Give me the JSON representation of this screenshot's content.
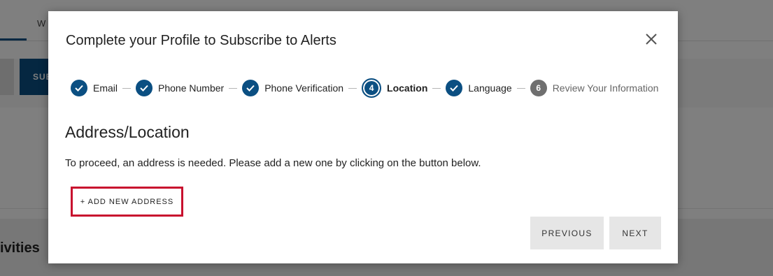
{
  "background": {
    "tab_label": "W",
    "sub_button_label": "SUB",
    "section_title": "ivities"
  },
  "modal": {
    "title": "Complete your Profile to Subscribe to Alerts",
    "close_icon": "close-icon",
    "steps": [
      {
        "label": "Email",
        "status": "complete"
      },
      {
        "label": "Phone Number",
        "status": "complete"
      },
      {
        "label": "Phone Verification",
        "status": "complete"
      },
      {
        "label": "Location",
        "status": "current",
        "number": "4"
      },
      {
        "label": "Language",
        "status": "complete"
      },
      {
        "label": "Review Your Information",
        "status": "pending",
        "number": "6"
      }
    ],
    "section_heading": "Address/Location",
    "info_text": "To proceed, an address is needed. Please add a new one by clicking on the button below.",
    "add_address_label": "+ ADD NEW ADDRESS",
    "previous_label": "PREVIOUS",
    "next_label": "NEXT"
  },
  "colors": {
    "accent": "#0b4f82",
    "highlight_border": "#c8102e",
    "pending_step": "#6f6f6f",
    "footer_button_bg": "#e6e6e6"
  }
}
